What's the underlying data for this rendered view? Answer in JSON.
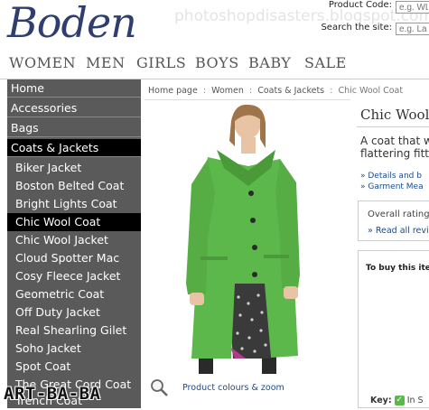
{
  "header": {
    "logo": "Boden",
    "watermark": "photoshopdisasters.blogspot.com",
    "product_code_label": "Product Code:",
    "product_code_placeholder": "e.g. WL",
    "search_label": "Search the site:",
    "search_placeholder": "e.g. La"
  },
  "topnav": [
    "WOMEN",
    "MEN",
    "GIRLS",
    "BOYS",
    "BABY",
    "SALE"
  ],
  "sidebar": {
    "categories": [
      "Home",
      "Accessories",
      "Bags",
      "Coats & Jackets"
    ],
    "active_category": "Coats & Jackets",
    "items": [
      "Biker Jacket",
      "Boston Belted Coat",
      "Bright Lights Coat",
      "Chic Wool Coat",
      "Chic Wool Jacket",
      "Cloud Spotter Mac",
      "Cosy Fleece Jacket",
      "Geometric Coat",
      "Off Duty Jacket",
      "Real Shearling Gilet",
      "Soho Jacket",
      "Spot Coat",
      "The Great Cord Coat",
      "Trench Coat"
    ],
    "active_item": "Chic Wool Coat"
  },
  "breadcrumb": {
    "items": [
      "Home page",
      "Women",
      "Coats & Jackets"
    ],
    "current": "Chic Wool Coat"
  },
  "product": {
    "title": "Chic Wool",
    "desc_line1": "A coat that w",
    "desc_line2": "flattering fitt",
    "link1": "» Details and b",
    "link2": "» Garment Mea",
    "rating_label": "Overall rating",
    "read_all": "» Read all revi",
    "buy_label": "To buy this ite",
    "key_label": "Key:",
    "key_value": "In S",
    "zoom_link": "Product colours & zoom"
  },
  "overlay_text": "ART-BA-BA",
  "colors": {
    "coat": "#5cb84a",
    "sidebar": "#5a5a5a",
    "active": "#000000",
    "link": "#1a4c8c",
    "logo": "#2f3e6e"
  }
}
